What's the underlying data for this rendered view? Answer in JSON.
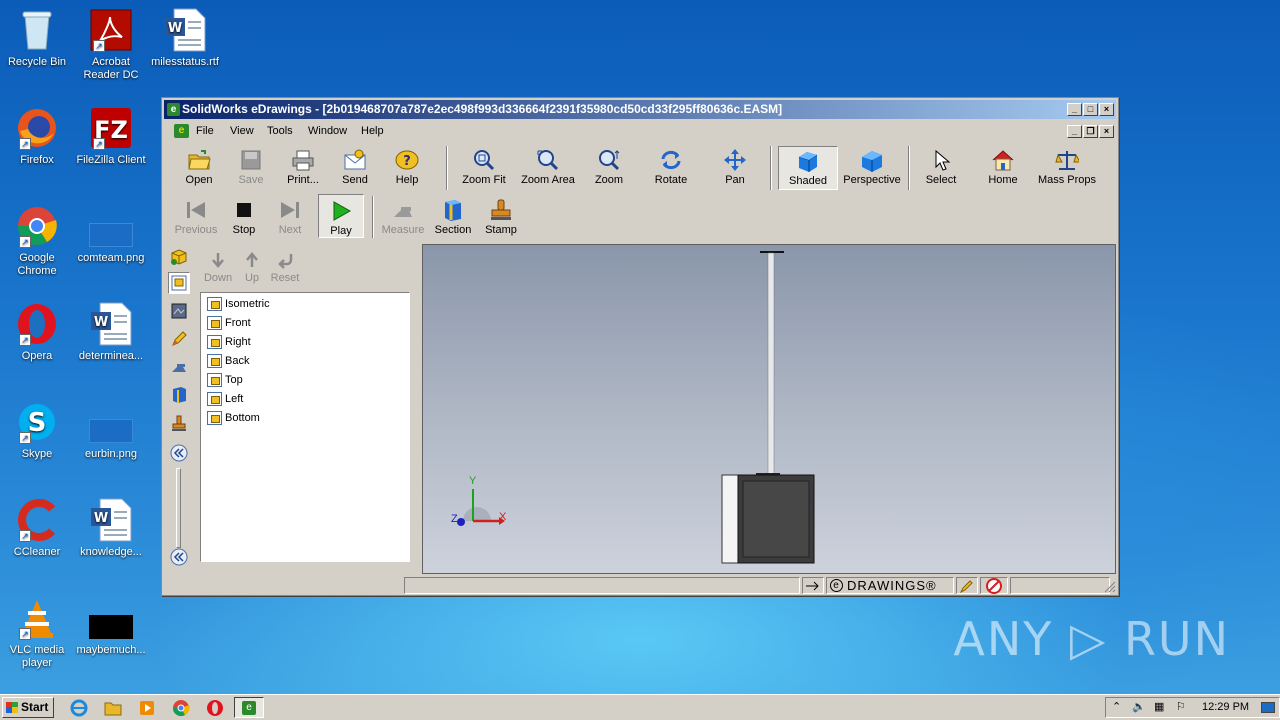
{
  "desktop": {
    "icons": [
      {
        "label": "Recycle Bin",
        "icon": "recycle-bin-icon"
      },
      {
        "label": "Acrobat Reader DC",
        "icon": "acrobat-icon"
      },
      {
        "label": "milesstatus.rtf",
        "icon": "word-doc-icon"
      },
      {
        "label": "Firefox",
        "icon": "firefox-icon"
      },
      {
        "label": "FileZilla Client",
        "icon": "filezilla-icon"
      },
      {
        "label": "Google Chrome",
        "icon": "chrome-icon"
      },
      {
        "label": "comteam.png",
        "icon": "image-file-icon"
      },
      {
        "label": "Opera",
        "icon": "opera-icon"
      },
      {
        "label": "determinea...",
        "icon": "word-doc-icon"
      },
      {
        "label": "Skype",
        "icon": "skype-icon"
      },
      {
        "label": "eurbin.png",
        "icon": "image-file-icon"
      },
      {
        "label": "CCleaner",
        "icon": "ccleaner-icon"
      },
      {
        "label": "knowledge...",
        "icon": "word-doc-icon"
      },
      {
        "label": "VLC media player",
        "icon": "vlc-icon"
      },
      {
        "label": "maybemuch...",
        "icon": "image-file-icon"
      }
    ],
    "watermark": "ANY ▷ RUN"
  },
  "window": {
    "title": "SolidWorks eDrawings - [2b019468707a787e2ec498f993d336664f2391f35980cd50cd33f295ff80636c.EASM]",
    "menu": [
      "File",
      "View",
      "Tools",
      "Window",
      "Help"
    ],
    "toolbar1": [
      {
        "label": "Open",
        "icon": "open-folder-icon",
        "enabled": true
      },
      {
        "label": "Save",
        "icon": "save-icon",
        "enabled": false
      },
      {
        "label": "Print...",
        "icon": "print-icon",
        "enabled": true
      },
      {
        "label": "Send",
        "icon": "send-envelope-icon",
        "enabled": true
      },
      {
        "label": "Help",
        "icon": "help-icon",
        "enabled": true
      },
      {
        "label": "Zoom Fit",
        "icon": "zoom-fit-icon",
        "enabled": true
      },
      {
        "label": "Zoom Area",
        "icon": "zoom-area-icon",
        "enabled": true
      },
      {
        "label": "Zoom",
        "icon": "zoom-icon",
        "enabled": true
      },
      {
        "label": "Rotate",
        "icon": "rotate-icon",
        "enabled": true
      },
      {
        "label": "Pan",
        "icon": "pan-icon",
        "enabled": true
      },
      {
        "label": "Shaded",
        "icon": "shaded-cube-icon",
        "enabled": true,
        "pressed": true
      },
      {
        "label": "Perspective",
        "icon": "perspective-icon",
        "enabled": true
      },
      {
        "label": "Select",
        "icon": "select-cursor-icon",
        "enabled": true
      },
      {
        "label": "Home",
        "icon": "home-icon",
        "enabled": true
      },
      {
        "label": "Mass Props",
        "icon": "mass-props-icon",
        "enabled": true
      }
    ],
    "toolbar2": [
      {
        "label": "Previous",
        "icon": "previous-icon",
        "enabled": false
      },
      {
        "label": "Stop",
        "icon": "stop-icon",
        "enabled": true
      },
      {
        "label": "Next",
        "icon": "next-icon",
        "enabled": false
      },
      {
        "label": "Play",
        "icon": "play-icon",
        "enabled": true,
        "pressed": true
      },
      {
        "label": "Measure",
        "icon": "measure-icon",
        "enabled": false
      },
      {
        "label": "Section",
        "icon": "section-icon",
        "enabled": true
      },
      {
        "label": "Stamp",
        "icon": "stamp-icon",
        "enabled": true
      }
    ],
    "panel_tools": [
      {
        "label": "Down",
        "icon": "arrow-down-icon"
      },
      {
        "label": "Up",
        "icon": "arrow-up-icon"
      },
      {
        "label": "Reset",
        "icon": "reset-icon"
      }
    ],
    "views": [
      "Isometric",
      "Front",
      "Right",
      "Back",
      "Top",
      "Left",
      "Bottom"
    ],
    "axes": {
      "x": "X",
      "y": "Y",
      "z": "Z"
    },
    "status": {
      "brand": "DRAWINGS®"
    }
  },
  "taskbar": {
    "start": "Start",
    "clock": "12:29 PM"
  },
  "colors": {
    "title_start": "#0a246a",
    "title_end": "#a6caf0",
    "chrome": "#d4d0c8",
    "green": "#2c8a2c"
  }
}
